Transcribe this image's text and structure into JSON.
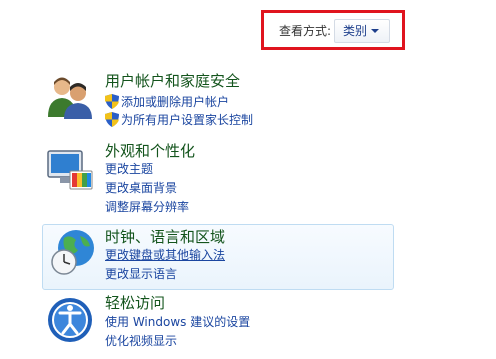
{
  "view_by": {
    "label": "查看方式:",
    "value": "类别"
  },
  "categories": [
    {
      "title": "用户帐户和家庭安全",
      "icon": "users-icon",
      "links": [
        "添加或删除用户帐户",
        "为所有用户设置家长控制"
      ]
    },
    {
      "title": "外观和个性化",
      "icon": "personalization-icon",
      "links": [
        "更改主题",
        "更改桌面背景",
        "调整屏幕分辨率"
      ]
    },
    {
      "title": "时钟、语言和区域",
      "icon": "clock-globe-icon",
      "links": [
        "更改键盘或其他输入法",
        "更改显示语言"
      ]
    },
    {
      "title": "轻松访问",
      "icon": "ease-of-access-icon",
      "links": [
        "使用 Windows 建议的设置",
        "优化视频显示"
      ]
    }
  ],
  "colors": {
    "title": "#13541c",
    "link": "#1b46a0",
    "highlight_box": "#e0141e"
  }
}
